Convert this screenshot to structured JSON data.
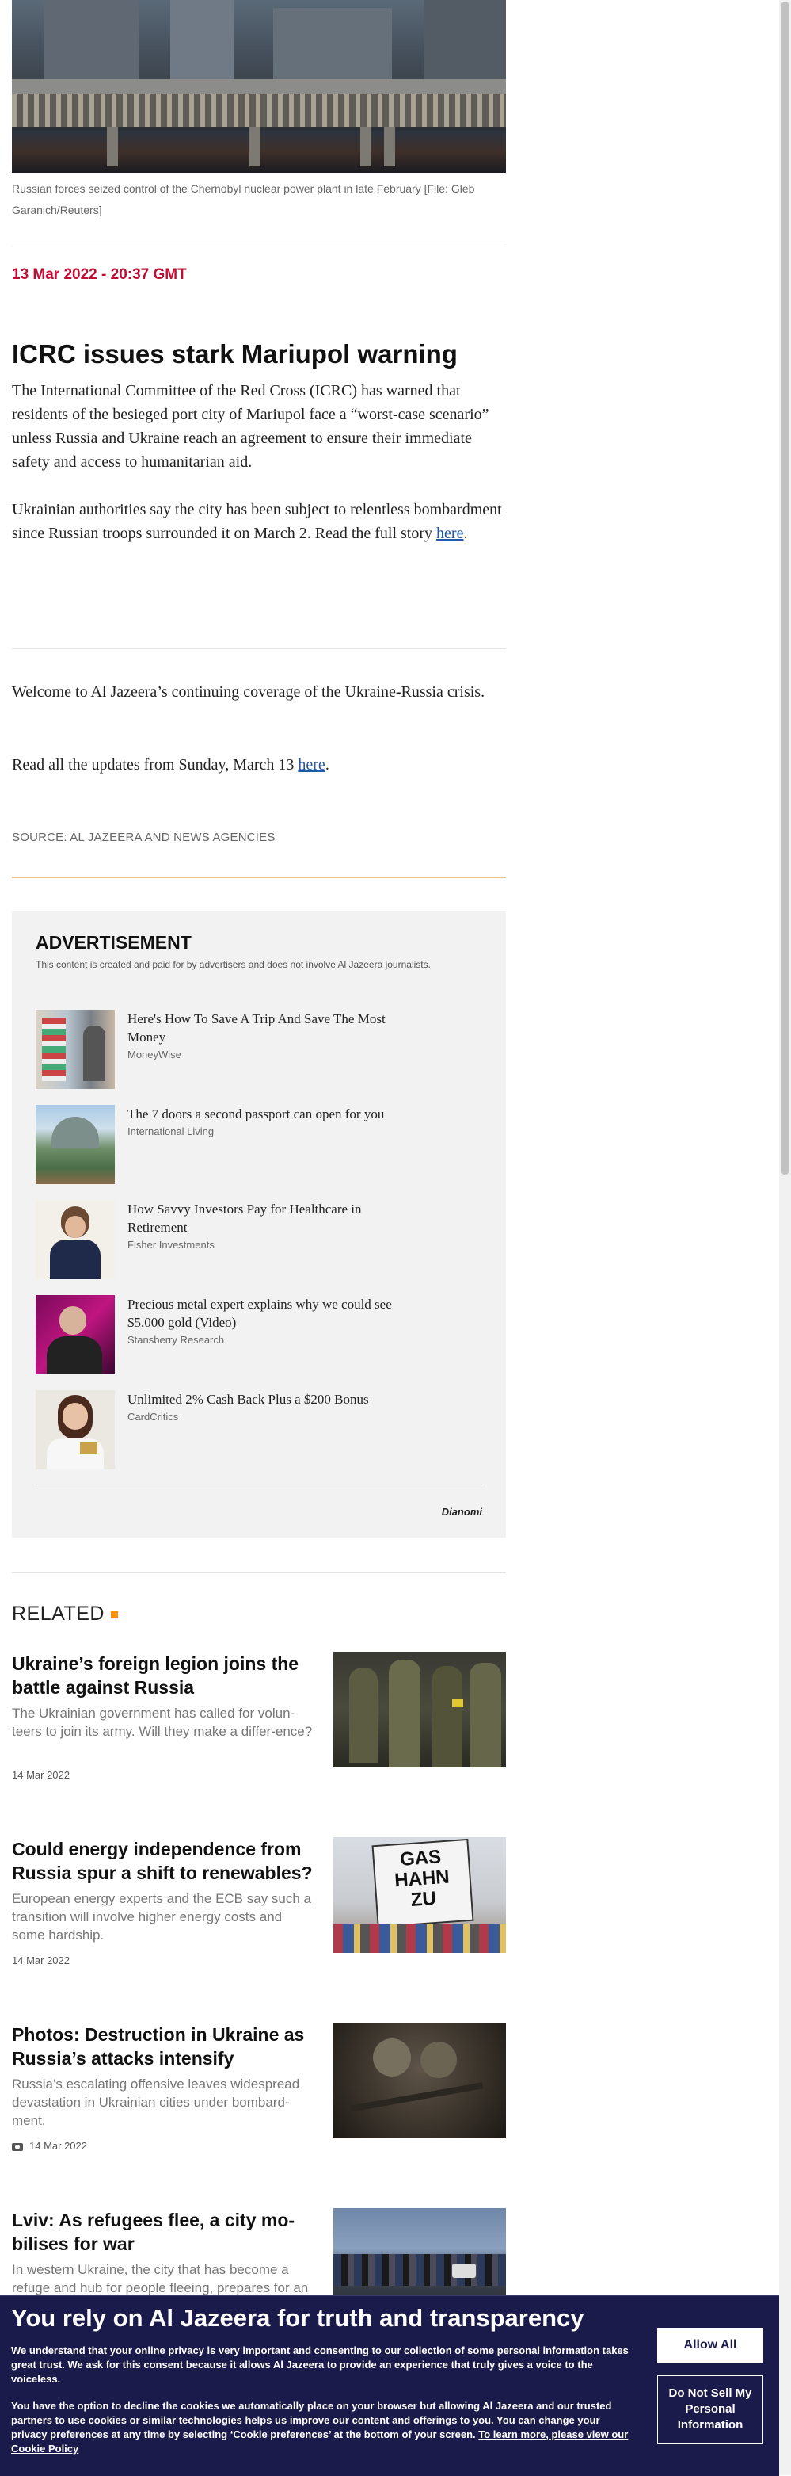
{
  "hero": {
    "caption": "Russian forces seized control of the Chernobyl nuclear power plant in late February [File: Gleb Garanich/Reuters]"
  },
  "update": {
    "timestamp": "13 Mar 2022 - 20:37 GMT",
    "title": "ICRC issues stark Mariupol warning",
    "p1": "The International Committee of the Red Cross (ICRC) has warned that residents of the besieged port city of Mariupol face a “worst-case scenario” unless Russia and Ukraine reach an agreement to ensure their immediate safety and access to humanitarian aid.",
    "p2_before": "Ukrainian authorities say the city has been subject to relentless bombardment since Russian troops surrounded it on March 2. Read the full story ",
    "p2_link": "here",
    "p2_after": "."
  },
  "intro": {
    "welcome": "Welcome to Al Jazeera’s continuing coverage of the Ukraine-Russia crisis.",
    "read_before": "Read all the updates from Sunday, March 13 ",
    "read_link": "here",
    "read_after": ".",
    "source": "SOURCE: AL JAZEERA AND NEWS AGENCIES"
  },
  "advertisement": {
    "title": "ADVERTISEMENT",
    "note": "This content is created and paid for by advertisers and does not involve Al Jazeera journalists.",
    "items": [
      {
        "headline": "Here's How To Save A Trip And Save The Most Money",
        "source": "MoneyWise"
      },
      {
        "headline": "The 7 doors a second passport can open for you",
        "source": "International Living"
      },
      {
        "headline": "How Savvy Investors Pay for Healthcare in Retirement",
        "source": "Fisher Investments"
      },
      {
        "headline": "Precious metal expert explains why we could see $5,000 gold (Video)",
        "source": "Stansberry Research"
      },
      {
        "headline": "Unlimited 2% Cash Back Plus a $200 Bonus",
        "source": "CardCritics"
      }
    ],
    "logo": "Dianomi"
  },
  "related": {
    "heading": "RELATED",
    "items": [
      {
        "title": "Ukraine’s foreign legion joins the battle against Russia",
        "desc": "The Ukrainian government has called for volun-teers to join its army. Will they make a differ-ence?",
        "date": "14 Mar 2022"
      },
      {
        "title": "Could energy independence from Russia spur a shift to renewables?",
        "desc": "European energy experts and the ECB say such a transition will involve higher energy costs and some hardship.",
        "date": "14 Mar 2022",
        "image_sign": "GAS HAHN ZU"
      },
      {
        "title": "Photos: Destruction in Ukraine as Russia’s attacks intensify",
        "desc": "Russia’s escalating offensive leaves widespread devastation in Ukrainian cities under bombard-ment.",
        "date": "14 Mar 2022",
        "icon": "camera-icon"
      },
      {
        "title": "Lviv: As refugees flee, a city mo-bilises for war",
        "desc": "In western Ukraine, the city that has become a refuge and hub for people fleeing, prepares for an",
        "date": ""
      }
    ]
  },
  "cookie": {
    "title": "You rely on Al Jazeera for truth and transparency",
    "p1": "We understand that your online privacy is very important and consenting to our collection of some personal information takes great trust. We ask for this consent because it allows Al Jazeera to provide an experience that truly gives a voice to the voiceless.",
    "p2": "You have the option to decline the cookies we automatically place on your browser but allowing Al Jazeera and our trusted partners to use cookies or similar technologies helps us improve our content and offerings to you. You can change your privacy preferences at any time by selecting ‘Cookie preferences’ at the bottom of your screen. ",
    "p2_link": "To learn more, please view our Cookie Policy",
    "allow_label": "Allow All",
    "dns_label": "Do Not Sell My Personal Information"
  },
  "colors": {
    "accent_red": "#c20c33",
    "brand_orange": "#fa9000",
    "banner_navy": "#1b1b4b",
    "link_blue": "#2158a5"
  }
}
